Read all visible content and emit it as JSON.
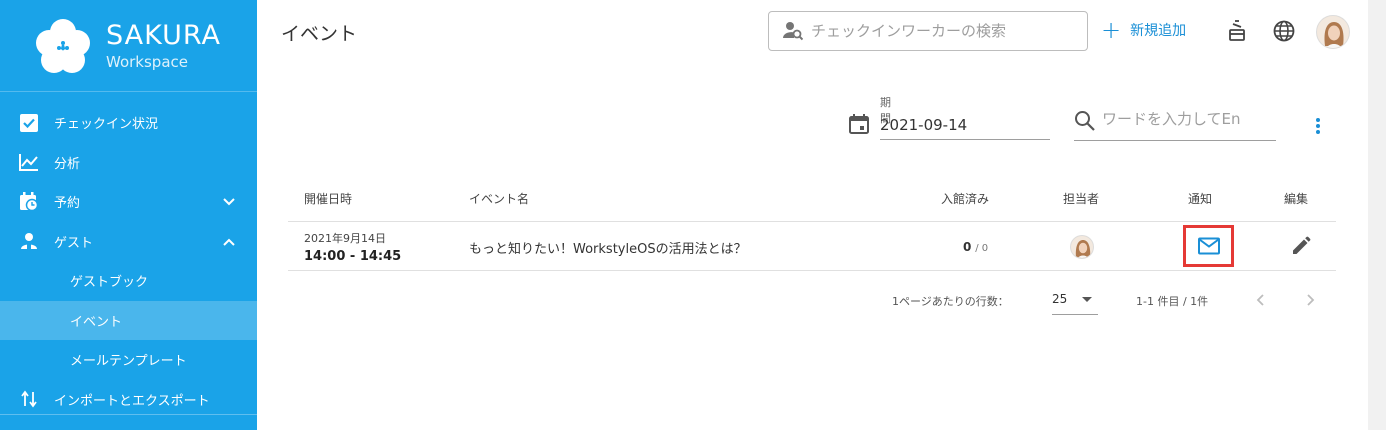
{
  "brand": {
    "name": "SAKURA",
    "sub": "Workspace",
    "logo_icon": "sakura-flower-icon"
  },
  "sidebar": {
    "items": [
      {
        "label": "チェックイン状況",
        "icon": "checkbox-icon"
      },
      {
        "label": "分析",
        "icon": "chart-line-icon"
      },
      {
        "label": "予約",
        "icon": "calendar-clock-icon",
        "expandable": "chevron-down"
      },
      {
        "label": "ゲスト",
        "icon": "guest-icon",
        "expandable": "chevron-up"
      },
      {
        "label": "インポートとエクスポート",
        "icon": "import-export-icon"
      }
    ],
    "sub_items": [
      {
        "label": "ゲストブック",
        "active": false
      },
      {
        "label": "イベント",
        "active": true
      },
      {
        "label": "メールテンプレート",
        "active": false
      }
    ]
  },
  "header": {
    "title": "イベント",
    "search_placeholder": "チェックインワーカーの検索",
    "add_label": "新規追加"
  },
  "filters": {
    "period_label": "期間",
    "period_value": "2021-09-14",
    "word_placeholder": "ワードを入力してEn"
  },
  "table": {
    "headers": {
      "date": "開催日時",
      "name": "イベント名",
      "checked_in": "入館済み",
      "owner": "担当者",
      "notify": "通知",
      "edit": "編集"
    },
    "rows": [
      {
        "date": "2021年9月14日",
        "time": "14:00 - 14:45",
        "name": "もっと知りたい！WorkstyleOSの活用法とは？",
        "checked_in": "0",
        "total": "/ 0"
      }
    ]
  },
  "pagination": {
    "rows_per_page_label": "1ページあたりの行数：",
    "rows_per_page": "25",
    "range": "1-1 件目 / 1件"
  },
  "colors": {
    "sidebar": "#1aa3e8",
    "accent": "#1a8fd6",
    "highlight": "#e53935"
  }
}
